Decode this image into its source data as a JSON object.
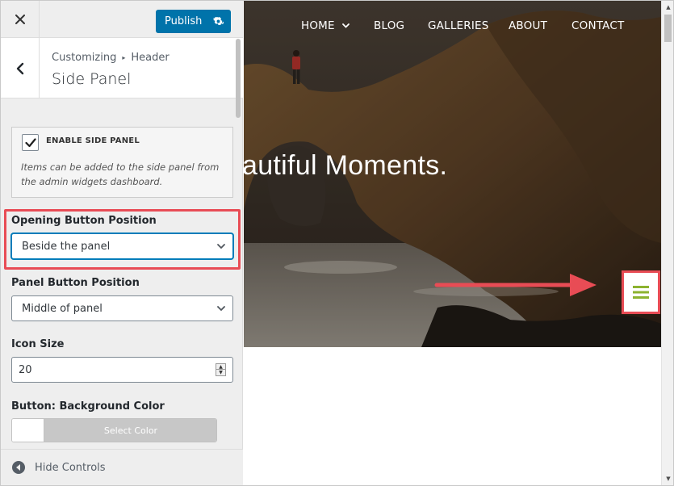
{
  "sidebar": {
    "publish_label": "Publish",
    "breadcrumb": {
      "parent": "Customizing",
      "current": "Header"
    },
    "section_title": "Side Panel",
    "enable_side_panel": {
      "label": "ENABLE SIDE PANEL",
      "checked": true,
      "description": "Items can be added to the side panel from the admin widgets dashboard."
    },
    "opening_button_position": {
      "label": "Opening Button Position",
      "value": "Beside the panel"
    },
    "panel_button_position": {
      "label": "Panel Button Position",
      "value": "Middle of panel"
    },
    "icon_size": {
      "label": "Icon Size",
      "value": "20"
    },
    "button_bg_color": {
      "label": "Button: Background Color",
      "button_text": "Select Color"
    },
    "hide_controls_label": "Hide Controls"
  },
  "preview": {
    "nav": {
      "items": [
        "HOME",
        "BLOG",
        "GALLERIES",
        "ABOUT",
        "CONTACT"
      ]
    },
    "hero_text": "autiful Moments.",
    "menu_icon_color": "#8cb32f"
  },
  "colors": {
    "accent": "#0073aa",
    "highlight": "#e84c55",
    "menu_icon": "#8cb32f"
  }
}
